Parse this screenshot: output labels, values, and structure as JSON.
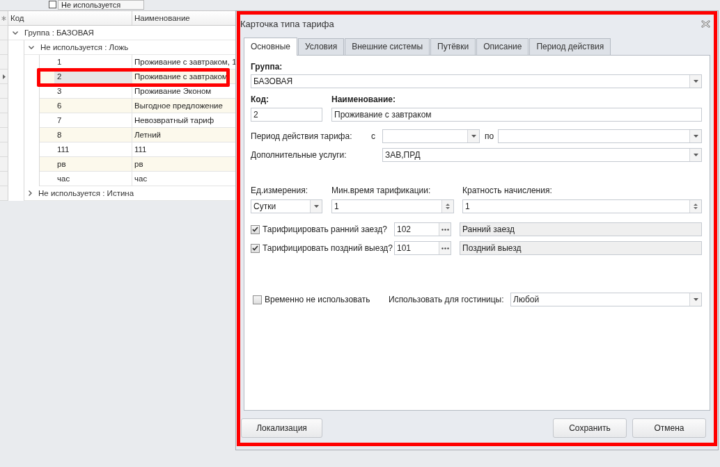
{
  "filter_bar": {
    "label": "Не используется",
    "checked": false
  },
  "grid": {
    "columns": [
      {
        "label": "Код"
      },
      {
        "label": "Наименование"
      }
    ],
    "groups": [
      {
        "label": "Группа : БАЗОВАЯ",
        "expanded": true,
        "children": [
          {
            "label": "Не используется : Ложь",
            "expanded": true,
            "rows": [
              {
                "code": "1",
                "name": "Проживание с завтраком, 1",
                "selected": false
              },
              {
                "code": "2",
                "name": "Проживание с завтраком",
                "selected": true
              },
              {
                "code": "3",
                "name": "Проживание Эконом",
                "selected": false
              },
              {
                "code": "6",
                "name": "Выгодное предложение",
                "selected": false
              },
              {
                "code": "7",
                "name": "Невозвратный тариф",
                "selected": false
              },
              {
                "code": "8",
                "name": "Летний",
                "selected": false
              },
              {
                "code": "111",
                "name": "111",
                "selected": false
              },
              {
                "code": "рв",
                "name": "рв",
                "selected": false
              },
              {
                "code": "час",
                "name": "час",
                "selected": false
              }
            ]
          },
          {
            "label": "Не используется : Истина",
            "expanded": false
          }
        ]
      }
    ]
  },
  "dialog": {
    "title": "Карточка типа тарифа",
    "tabs": [
      {
        "label": "Основные",
        "selected": true
      },
      {
        "label": "Условия",
        "selected": false
      },
      {
        "label": "Внешние системы",
        "selected": false
      },
      {
        "label": "Путёвки",
        "selected": false
      },
      {
        "label": "Описание",
        "selected": false
      },
      {
        "label": "Период действия",
        "selected": false
      }
    ],
    "form": {
      "group": {
        "label": "Группа:",
        "value": "БАЗОВАЯ"
      },
      "code": {
        "label": "Код:",
        "value": "2"
      },
      "name": {
        "label": "Наименование:",
        "value": "Проживание с завтраком"
      },
      "period": {
        "label": "Период действия тарифа:",
        "from_label": "с",
        "to_label": "по"
      },
      "services": {
        "label": "Дополнительные услуги:",
        "value": "ЗАВ,ПРД"
      },
      "unit": {
        "label": "Ед.измерения:",
        "value": "Сутки"
      },
      "min_time": {
        "label": "Мин.время тарификации:",
        "value": "1"
      },
      "multiplicity": {
        "label": "Кратность начисления:",
        "value": "1"
      },
      "charge_options": [
        {
          "label": "Тарифицировать ранний заезд?",
          "checked": true,
          "code": "102",
          "description": "Ранний заезд"
        },
        {
          "label": "Тарифицировать поздний выезд?",
          "checked": true,
          "code": "101",
          "description": "Поздний выезд"
        }
      ],
      "temporarily_unused": {
        "label": "Временно не использовать",
        "checked": false
      },
      "hotel": {
        "label": "Использовать для гостиницы:",
        "value": "Любой"
      }
    },
    "left_buttons": [
      {
        "label": "Локализация"
      }
    ],
    "right_buttons": [
      {
        "label": "Сохранить"
      },
      {
        "label": "Отмена"
      }
    ]
  }
}
